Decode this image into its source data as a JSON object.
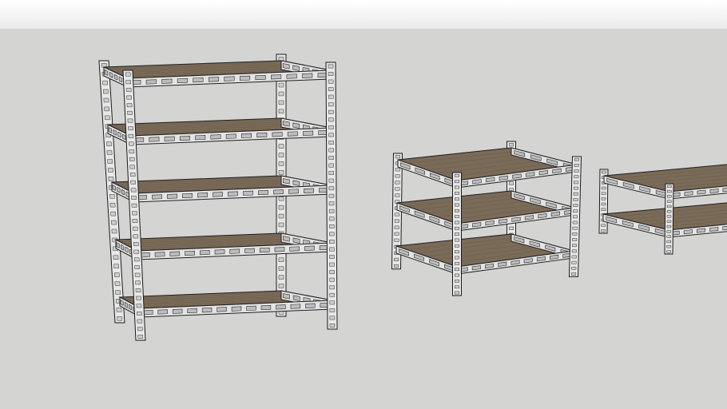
{
  "scene": {
    "background_colors": {
      "sky": "#ffffff",
      "ground": "#d4d4d2",
      "wood": "#7a6a58",
      "steel": "#e4e4e4"
    },
    "units": [
      {
        "name": "tall-shelf-unit",
        "shelf_count": 5
      },
      {
        "name": "medium-shelf-unit",
        "shelf_count": 3
      },
      {
        "name": "small-shelf-unit",
        "shelf_count": 2
      }
    ]
  }
}
